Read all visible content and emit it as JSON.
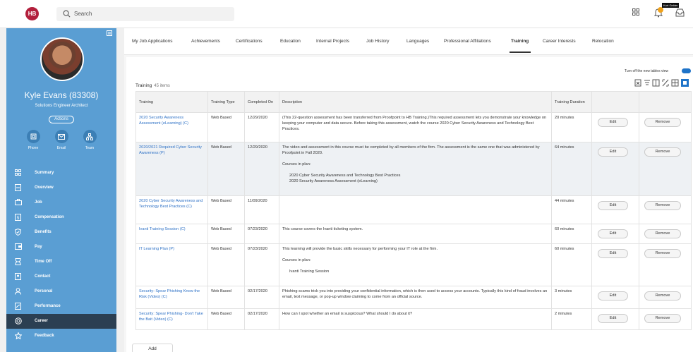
{
  "header": {
    "logo_text": "HB",
    "search_placeholder": "Search",
    "user_tag": "Kurt Gelder"
  },
  "profile": {
    "name": "Kyle Evans (83308)",
    "title": "Solutions Engineer Architect",
    "actions_label": "Actions",
    "quick_actions": [
      {
        "label": "Phone",
        "icon": "phone-icon"
      },
      {
        "label": "Email",
        "icon": "email-icon"
      },
      {
        "label": "Team",
        "icon": "team-icon"
      }
    ]
  },
  "nav": [
    {
      "label": "Summary",
      "icon": "grid-icon"
    },
    {
      "label": "Overview",
      "icon": "document-icon"
    },
    {
      "label": "Job",
      "icon": "briefcase-icon"
    },
    {
      "label": "Compensation",
      "icon": "compensation-icon"
    },
    {
      "label": "Benefits",
      "icon": "shield-icon"
    },
    {
      "label": "Pay",
      "icon": "pay-icon"
    },
    {
      "label": "Time Off",
      "icon": "time-off-icon"
    },
    {
      "label": "Contact",
      "icon": "contact-icon"
    },
    {
      "label": "Personal",
      "icon": "person-icon"
    },
    {
      "label": "Performance",
      "icon": "performance-icon"
    },
    {
      "label": "Career",
      "icon": "career-icon"
    },
    {
      "label": "Feedback",
      "icon": "star-icon"
    }
  ],
  "tabs": [
    "My Job Applications",
    "Achievements",
    "Certifications",
    "Education",
    "Internal Projects",
    "Job History",
    "Languages",
    "Professional Affiliations",
    "Training",
    "Career Interests",
    "Relocation"
  ],
  "active_tab": "Training",
  "table": {
    "title": "Training",
    "count": "45 items",
    "toggle_label": "Turn off the new tables view",
    "headers": [
      "Training",
      "Training Type",
      "Completed On",
      "Description",
      "Training Duration",
      "",
      ""
    ],
    "edit_label": "Edit",
    "remove_label": "Remove",
    "courses_label": "Courses in plan:",
    "rows": [
      {
        "training": "2020 Security Awareness Assessment (eLearning) (C)",
        "type": "Web Based",
        "completed": "12/29/2020",
        "description": "(This 22-question assessment has been transferred from Proofpoint to HB Training.)This required assessment lets you demonstrate your knowledge on keeping your computer and data secure. Before taking this assessment, watch the course 2020 Cyber Security Awareness and Technology Best Practices.",
        "courses": [],
        "duration": "20 minutes"
      },
      {
        "training": "2020/2021 Required Cyber Security Awareness (P)",
        "type": "Web Based",
        "completed": "12/29/2020",
        "description": "The video and assessment in this course must be completed by all members of the firm. The assessment is the same one that was administered by Proofpoint in Fall 2020.",
        "courses": [
          "2020 Cyber Security Awareness and Technology Best Practices",
          "2020 Security Awareness Assessment (eLearning)"
        ],
        "duration": "64 minutes"
      },
      {
        "training": "2020 Cyber Security Awareness and Technology Best Practices (C)",
        "type": "Web Based",
        "completed": "11/09/2020",
        "description": "",
        "courses": [],
        "duration": "44 minutes"
      },
      {
        "training": "Ivanti Training Session (C)",
        "type": "Web Based",
        "completed": "07/23/2020",
        "description": "This course covers the Ivanti ticketing system.",
        "courses": [],
        "duration": "60 minutes"
      },
      {
        "training": "IT Learning Plan (P)",
        "type": "Web Based",
        "completed": "07/23/2020",
        "description": "This learning will provide the basic skills necessary for performing your IT role at the firm.",
        "courses": [
          "Ivanti Training Session"
        ],
        "duration": "60 minutes"
      },
      {
        "training": "Security: Spear Phishing Know the Risk (Video) (C)",
        "type": "Web Based",
        "completed": "02/17/2020",
        "description": "Phishing scams trick you into providing your confidential information, which is then used to access your accounts. Typically this kind of fraud involves an email, text message, or pop-up window claiming to come from an official source.",
        "courses": [],
        "duration": "3 minutes"
      },
      {
        "training": "Security: Spear Phishing- Don't Take the Bait (Video) (C)",
        "type": "Web Based",
        "completed": "02/17/2020",
        "description": "How can I spot whether an email is suspicious? What should I do about it?",
        "courses": [],
        "duration": "2 minutes"
      }
    ],
    "add_label": "Add"
  }
}
